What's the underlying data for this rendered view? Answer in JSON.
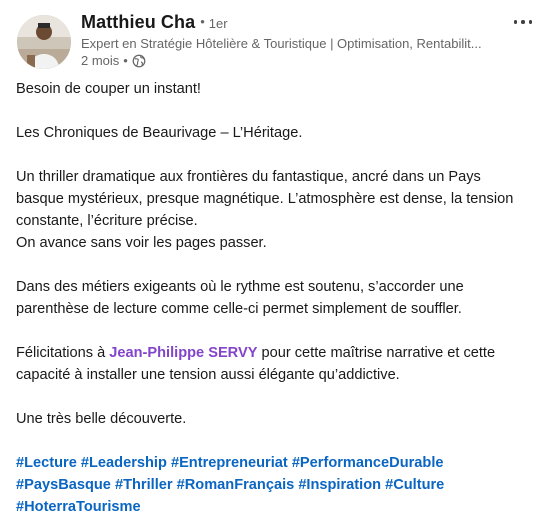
{
  "author": {
    "name": "Matthieu Cha",
    "separator": "•",
    "degree": "1er",
    "headline": "Expert en Stratégie Hôtelière & Touristique | Optimisation, Rentabilit...",
    "time": "2 mois",
    "meta_separator": "•",
    "visibility_icon": "globe-icon"
  },
  "menu": {
    "icon": "more-options-icon"
  },
  "post": {
    "p1": "Besoin de couper un instant!",
    "p2": "Les Chroniques de Beaurivage – L’Héritage.",
    "p3_l1": "Un thriller dramatique aux frontières du fantastique, ancré dans un Pays",
    "p3_l2": "basque mystérieux, presque magnétique. L’atmosphère est dense, la tension",
    "p3_l3": "constante, l’écriture précise.",
    "p3_l4": "On avance sans voir les pages passer.",
    "p4_l1": "Dans des métiers exigeants où le rythme est soutenu, s’accorder une",
    "p4_l2": "parenthèse de lecture comme celle-ci permet simplement de souffler.",
    "p5_before": "Félicitations à ",
    "p5_mention": "Jean-Philippe SERVY",
    "p5_after": " pour cette maîtrise narrative et cette",
    "p5_l2": "capacité à installer une tension aussi élégante qu’addictive.",
    "p6": "Une très belle découverte."
  },
  "hashtags": {
    "line1": [
      "#Lecture",
      "#Leadership",
      "#Entrepreneuriat",
      "#PerformanceDurable"
    ],
    "line2": [
      "#PaysBasque",
      "#Thriller",
      "#RomanFrançais",
      "#Inspiration",
      "#Culture"
    ],
    "line3": [
      "#HoterraTourisme"
    ]
  },
  "colors": {
    "text": "#191919",
    "secondary": "#666666",
    "hashtag": "#0a66c2",
    "mention": "#8344cc"
  }
}
